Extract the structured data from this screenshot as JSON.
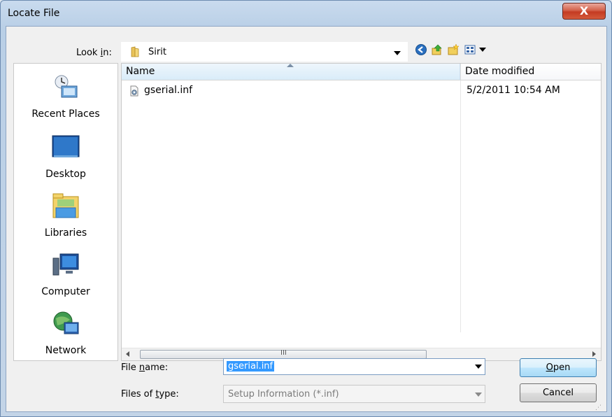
{
  "window": {
    "title": "Locate File",
    "close_label": "X"
  },
  "toolbar": {
    "lookin_label_pre": "Look ",
    "lookin_label_ul": "i",
    "lookin_label_post": "n:",
    "lookin_value": "Sirit",
    "icons": [
      "back-icon",
      "up-folder-icon",
      "new-folder-icon",
      "views-menu-icon"
    ]
  },
  "places": [
    {
      "label": "Recent Places",
      "icon": "recent-places-icon"
    },
    {
      "label": "Desktop",
      "icon": "desktop-icon"
    },
    {
      "label": "Libraries",
      "icon": "libraries-icon"
    },
    {
      "label": "Computer",
      "icon": "computer-icon"
    },
    {
      "label": "Network",
      "icon": "network-icon"
    }
  ],
  "filelist": {
    "columns": {
      "name": "Name",
      "date": "Date modified"
    },
    "rows": [
      {
        "name": "gserial.inf",
        "date": "5/2/2011 10:54 AM",
        "icon": "setup-file-icon"
      }
    ],
    "scroll_grip": "III"
  },
  "form": {
    "filename_label_pre": "File ",
    "filename_label_ul": "n",
    "filename_label_post": "ame:",
    "filename_value": "gserial.inf",
    "filetype_label_pre": "Files of ",
    "filetype_label_ul": "t",
    "filetype_label_post": "ype:",
    "filetype_value": "Setup Information (*.inf)",
    "open_label_ul": "O",
    "open_label_post": "pen",
    "cancel_label": "Cancel"
  }
}
